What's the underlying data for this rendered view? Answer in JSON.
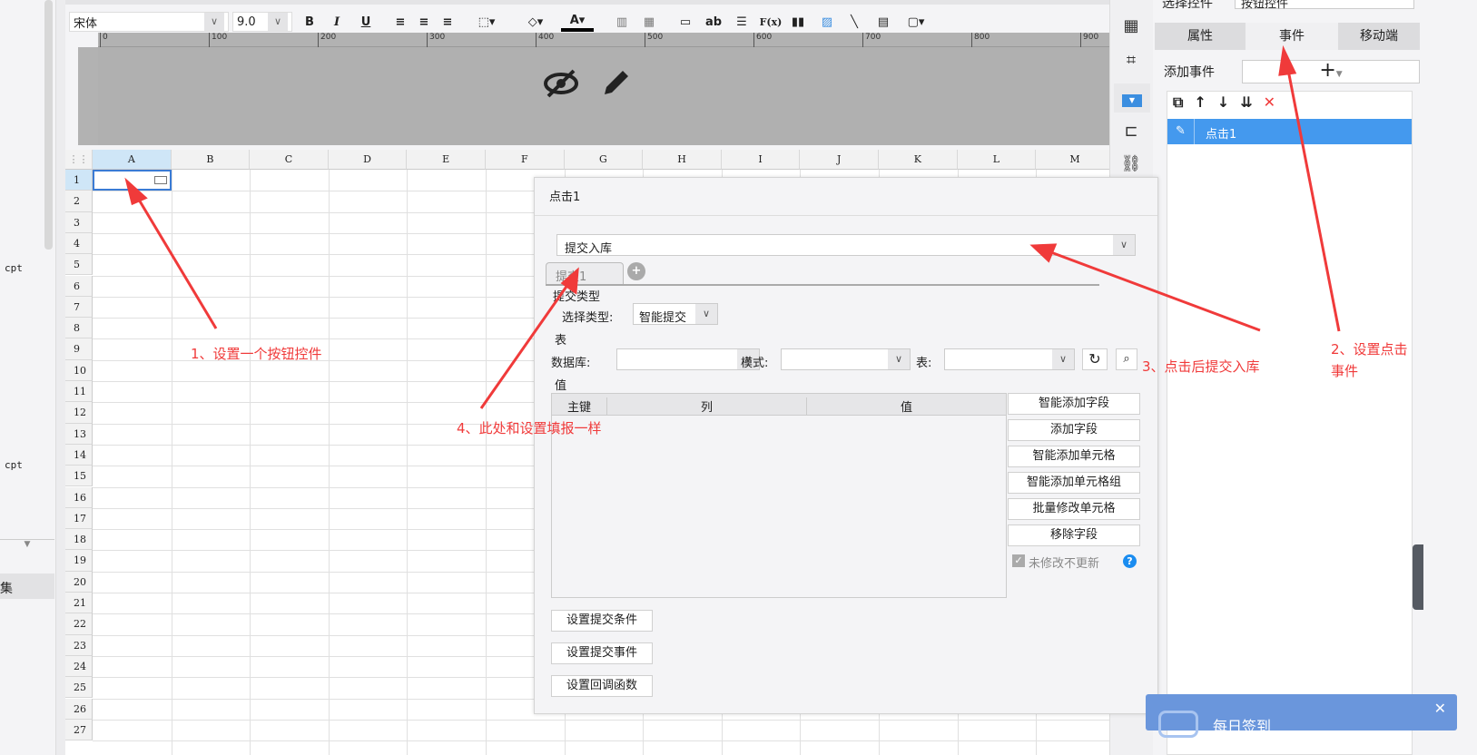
{
  "left_panel": {
    "items": [
      "cpt",
      "cpt"
    ],
    "section": "集"
  },
  "toolbar": {
    "font": "宋体",
    "size": "9.0",
    "bold": "B",
    "italic": "I",
    "underline": "U",
    "font_color": "A",
    "text_ab": "ab",
    "formula": "F(x)"
  },
  "ruler": {
    "ticks": [
      "0",
      "100",
      "200",
      "300",
      "400",
      "500",
      "600",
      "700",
      "800",
      "900"
    ]
  },
  "grid": {
    "columns": [
      "A",
      "B",
      "C",
      "D",
      "E",
      "F",
      "G",
      "H",
      "I",
      "J",
      "K",
      "L",
      "M"
    ],
    "rows": [
      "1",
      "2",
      "3",
      "4",
      "5",
      "6",
      "7",
      "8",
      "9",
      "10",
      "11",
      "12",
      "13",
      "14",
      "15",
      "16",
      "17",
      "18",
      "19",
      "20",
      "21",
      "22",
      "23",
      "24",
      "25",
      "26",
      "27"
    ]
  },
  "right_panel": {
    "select_label": "选择控件",
    "select_value": "按钮控件",
    "tabs": [
      "属性",
      "事件",
      "移动端"
    ],
    "active_tab": "事件",
    "add_event_label": "添加事件",
    "add_symbol": "+",
    "events": [
      {
        "name": "点击1",
        "selected": true
      }
    ]
  },
  "dialog": {
    "title": "点击1",
    "action": "提交入库",
    "submit_tab": "提交1",
    "submit_type_section": "提交类型",
    "select_type_label": "选择类型:",
    "select_type_value": "智能提交",
    "table_section": "表",
    "database_label": "数据库:",
    "schema_label": "模式:",
    "table_label": "表:",
    "value_section": "值",
    "table_headers": [
      "主键",
      "列",
      "值"
    ],
    "side_buttons": [
      "智能添加字段",
      "添加字段",
      "智能添加单元格",
      "智能添加单元格组",
      "批量修改单元格",
      "移除字段"
    ],
    "unmodified_checkbox": "未修改不更新",
    "unmodified_checked": true,
    "bottom_buttons": [
      "设置提交条件",
      "设置提交事件",
      "设置回调函数"
    ]
  },
  "annotations": [
    "1、设置一个按钮控件",
    "2、设置点击事件",
    "3、点击后提交入库",
    "4、此处和设置填报一样"
  ],
  "annotation_color": "#f03a3a",
  "popup": {
    "title": "每日签到",
    "close": "✕"
  }
}
